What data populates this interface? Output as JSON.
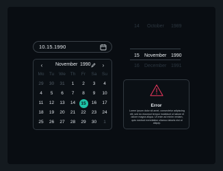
{
  "date_input": {
    "value": "10.15.1990",
    "icon": "calendar-icon"
  },
  "calendar": {
    "month": "November",
    "year": "1990",
    "prev_label": "‹",
    "next_label": "›",
    "weekdays": [
      "Mo",
      "Tu",
      "We",
      "Th",
      "Fr",
      "Sa",
      "Su"
    ],
    "weeks": [
      [
        "29",
        "30",
        "31",
        "1",
        "2",
        "3",
        "4"
      ],
      [
        "4",
        "5",
        "6",
        "7",
        "8",
        "9",
        "10"
      ],
      [
        "11",
        "12",
        "13",
        "14",
        "15",
        "16",
        "17"
      ],
      [
        "18",
        "19",
        "20",
        "21",
        "22",
        "23",
        "24"
      ],
      [
        "25",
        "26",
        "27",
        "28",
        "29",
        "30",
        "1"
      ]
    ],
    "selected": "15"
  },
  "wheel": {
    "rows": [
      {
        "day": "14",
        "month": "October",
        "year": "1989"
      },
      {
        "day": "15",
        "month": "November",
        "year": "1990"
      },
      {
        "day": "16",
        "month": "December",
        "year": "1991"
      }
    ]
  },
  "error": {
    "title": "Error",
    "message": "Lorem ipsum dolor sit amet, consectetur adipiscing elit, sed do eiusmod tempor incididunt ut labore et dolore magna aliqua. Ut enim ad minim veniam, quis nostrud exercitation ullamco laboris nisi ut aliquip.",
    "accent_color": "#e0355a"
  },
  "colors": {
    "accent": "#1ec2a6",
    "background": "#141a1f",
    "panel": "#090d12"
  }
}
